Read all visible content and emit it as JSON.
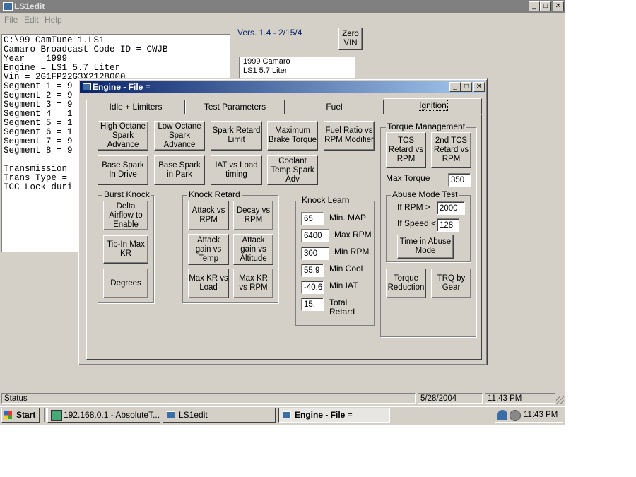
{
  "app": {
    "title": "LS1edit",
    "menu": [
      "File",
      "Edit",
      "Help"
    ],
    "version": "Vers. 1.4 - 2/15/4",
    "zero_vin": "Zero\nVIN",
    "car_box": [
      "1999 Camaro",
      "LS1 5.7 Liter"
    ],
    "info_lines": [
      "C:\\99-CamTune-1.LS1",
      "Camaro Broadcast Code ID = CWJB",
      "Year =  1999",
      "Engine = LS1 5.7 Liter",
      "Vin = 2G1FP22G3X2128000",
      "Segment 1 = 9",
      "Segment 2 = 9",
      "Segment 3 = 9",
      "Segment 4 = 1",
      "Segment 5 = 1",
      "Segment 6 = 1",
      "Segment 7 = 9",
      "Segment 8 = 9",
      "",
      "Transmission",
      "Trans Type =",
      "TCC Lock duri"
    ]
  },
  "status": {
    "label": "Status",
    "date": "5/28/2004",
    "time": "11:43 PM"
  },
  "taskbar": {
    "start": "Start",
    "tasks": [
      "192.168.0.1 - AbsoluteT...",
      "LS1edit",
      "Engine - File ="
    ],
    "clock": "11:43 PM"
  },
  "dialog": {
    "title": "Engine - File =",
    "tabs": [
      "Idle + Limiters",
      "Test Parameters",
      "Fuel",
      "Ignition"
    ],
    "buttons": {
      "high_octane": "High Octane Spark Advance",
      "low_octane": "Low Octane Spark Advance",
      "spark_retard": "Spark Retard Limit",
      "max_brake": "Maximum Brake Torque",
      "fuel_ratio": "Fuel Ratio vs RPM Modifier",
      "base_drive": "Base Spark In Drive",
      "base_park": "Base Spark in Park",
      "iat_load": "IAT vs Load timing",
      "coolant": "Coolant Temp Spark Adv",
      "delta_airflow": "Delta Airflow to Enable",
      "tipin": "Tip-In Max KR",
      "degrees": "Degrees",
      "attack_rpm": "Attack vs RPM",
      "decay_rpm": "Decay vs RPM",
      "attack_temp": "Attack gain vs Temp",
      "attack_alt": "Attack gain vs Altitude",
      "maxkr_load": "Max KR vs Load",
      "maxkr_rpm": "Max KR vs RPM",
      "tcs_retard": "TCS Retard vs RPM",
      "tcs2_retard": "2nd TCS Retard vs RPM",
      "time_abuse": "Time in Abuse Mode",
      "torque_red": "Torque Reduction",
      "trq_gear": "TRQ by Gear"
    },
    "groups": {
      "burst_knock": "Burst Knock",
      "knock_retard": "Knock Retard",
      "knock_learn": "Knock Learn",
      "torque_mgmt": "Torque Management",
      "abuse_mode": "Abuse Mode Test"
    },
    "knock_learn": [
      {
        "value": "65",
        "label": "Min. MAP"
      },
      {
        "value": "6400",
        "label": "Max RPM"
      },
      {
        "value": "300",
        "label": "Min RPM"
      },
      {
        "value": "55.9",
        "label": "Min Cool"
      },
      {
        "value": "-40.6",
        "label": "Min IAT"
      },
      {
        "value": "15.",
        "label": "Total\nRetard"
      }
    ],
    "max_torque": {
      "label": "Max Torque",
      "value": "350"
    },
    "abuse": {
      "rpm_label": "If RPM >",
      "rpm_value": "2000",
      "speed_label": "If Speed <",
      "speed_value": "128"
    }
  }
}
